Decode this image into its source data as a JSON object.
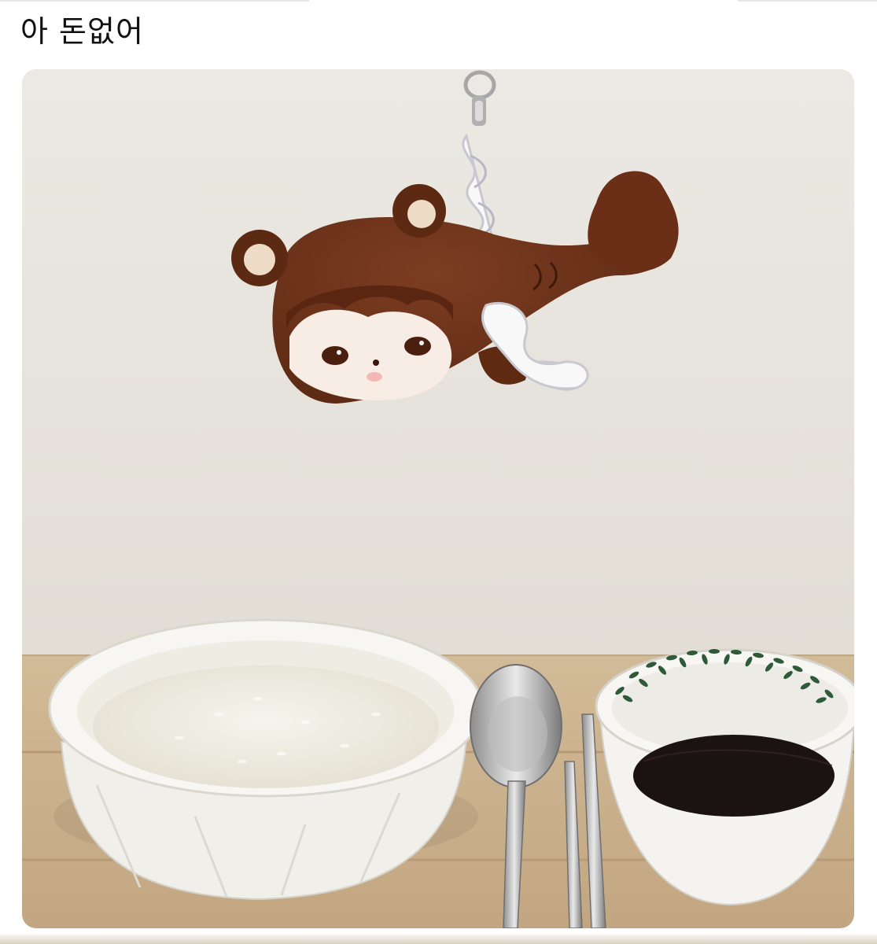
{
  "post": {
    "text": "아 돈없어"
  },
  "media": {
    "alt_icon": "photo-icon"
  },
  "colors": {
    "wall": "#e9e6e0",
    "table": "#c9b08d",
    "plush_brown": "#6b3119",
    "rice": "#f3f1e8",
    "soy_sauce": "#1b1312",
    "leaf_green": "#2f5a3a"
  }
}
